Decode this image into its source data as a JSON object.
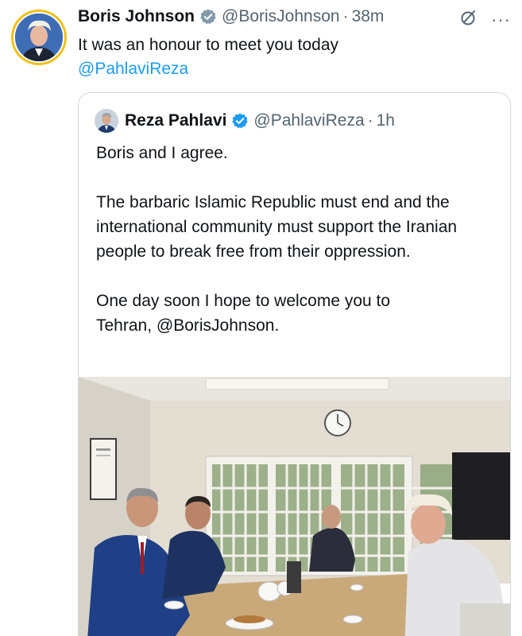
{
  "tweet": {
    "author_name": "Boris Johnson",
    "author_handle": "@BorisJohnson",
    "separator": "·",
    "time": "38m",
    "text": "It was an honour to meet you today",
    "mention": "@PahlaviReza"
  },
  "quote": {
    "author_name": "Reza Pahlavi",
    "author_handle": "@PahlaviReza",
    "separator": "·",
    "time": "1h",
    "paragraphs": [
      "Boris and I agree.",
      "The barbaric Islamic Republic must end and the international community must support the Iranian people to break free from their oppression.",
      "One day soon I hope to welcome you to"
    ],
    "closing_line_mention": "Tehran, @BorisJohnson."
  },
  "icons": {
    "verified": "verified-badge-icon",
    "grok": "grok-icon",
    "more": "more-icon"
  },
  "colors": {
    "link": "#1d9bf0",
    "secondary_text": "#536471",
    "verified_badge": "#829aab",
    "verified_badge_quote": "#1d9bf0",
    "avatar_ring": "#f2c014"
  }
}
